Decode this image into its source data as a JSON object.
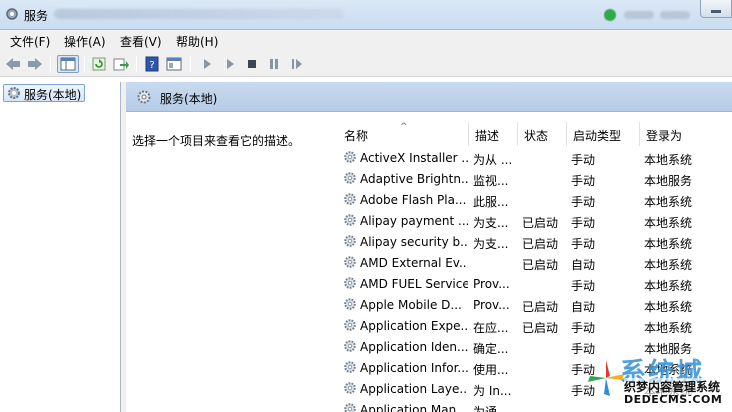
{
  "window": {
    "title": "服务"
  },
  "menu": [
    "文件(F)",
    "操作(A)",
    "查看(V)",
    "帮助(H)"
  ],
  "tree": {
    "item_label": "服务(本地)"
  },
  "pane": {
    "title": "服务(本地)",
    "description": "选择一个项目来查看它的描述。"
  },
  "columns": [
    "名称",
    "描述",
    "状态",
    "启动类型",
    "登录为"
  ],
  "services": [
    {
      "name": "ActiveX Installer ...",
      "desc": "为从 ...",
      "status": "",
      "startup": "手动",
      "logon": "本地系统"
    },
    {
      "name": "Adaptive Brightn...",
      "desc": "监视...",
      "status": "",
      "startup": "手动",
      "logon": "本地服务"
    },
    {
      "name": "Adobe Flash Pla...",
      "desc": "此服...",
      "status": "",
      "startup": "手动",
      "logon": "本地系统"
    },
    {
      "name": "Alipay payment ...",
      "desc": "为支...",
      "status": "已启动",
      "startup": "手动",
      "logon": "本地系统"
    },
    {
      "name": "Alipay security b...",
      "desc": "为支...",
      "status": "已启动",
      "startup": "手动",
      "logon": "本地系统"
    },
    {
      "name": "AMD External Ev...",
      "desc": "",
      "status": "已启动",
      "startup": "自动",
      "logon": "本地系统"
    },
    {
      "name": "AMD FUEL Service",
      "desc": "Prov...",
      "status": "",
      "startup": "手动",
      "logon": "本地系统"
    },
    {
      "name": "Apple Mobile D...",
      "desc": "Prov...",
      "status": "已启动",
      "startup": "自动",
      "logon": "本地系统"
    },
    {
      "name": "Application Expe...",
      "desc": "在应...",
      "status": "已启动",
      "startup": "手动",
      "logon": "本地系统"
    },
    {
      "name": "Application Iden...",
      "desc": "确定...",
      "status": "",
      "startup": "手动",
      "logon": "本地服务"
    },
    {
      "name": "Application Infor...",
      "desc": "使用...",
      "status": "",
      "startup": "手动",
      "logon": "本地系统"
    },
    {
      "name": "Application Laye...",
      "desc": "为 In...",
      "status": "",
      "startup": "手动",
      "logon": "本地系统"
    },
    {
      "name": "Application Man...",
      "desc": "为通...",
      "status": "",
      "startup": "",
      "logon": ""
    }
  ],
  "watermark": {
    "brand": "系统城",
    "tagline": "织梦内容管理系统",
    "url": "DEDECMS.COM"
  },
  "colors": {
    "accent": "#3c96d7",
    "header": "#c8daef"
  },
  "icons": {
    "gear": "gear-icon",
    "app": "services-icon"
  }
}
